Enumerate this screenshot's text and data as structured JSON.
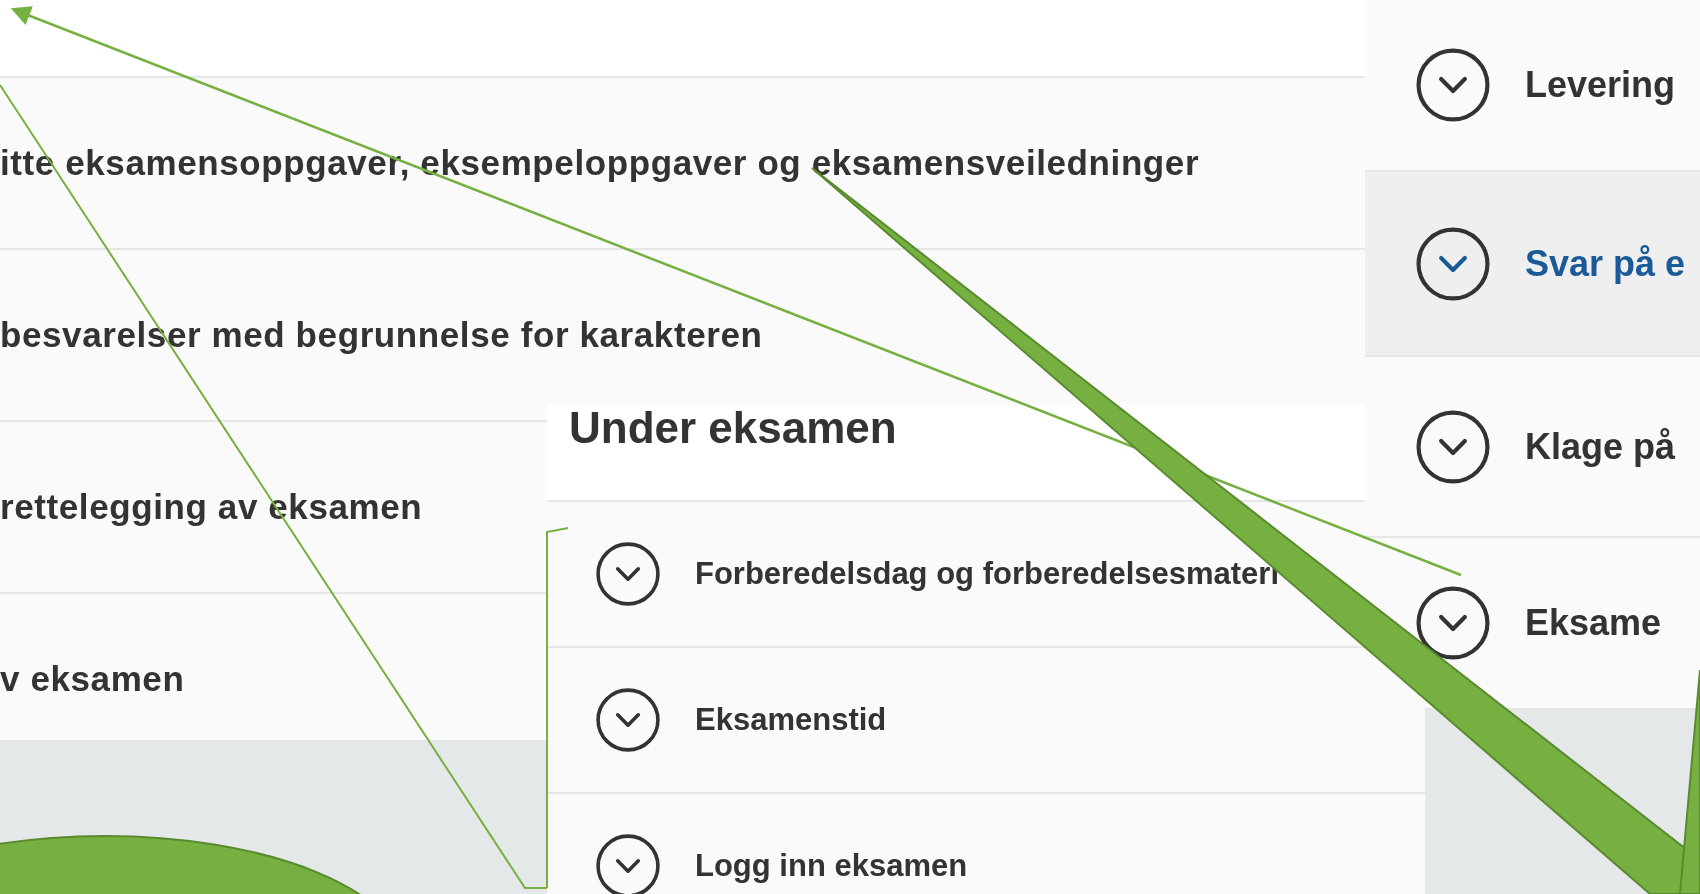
{
  "left_panel": {
    "items": [
      {
        "label": "itte eksamensoppgaver, eksempeloppgaver og eksamensveiledninger"
      },
      {
        "label": "besvarelser med begrunnelse for karakteren"
      },
      {
        "label": "rettelegging av eksamen"
      },
      {
        "label": "v eksamen"
      }
    ]
  },
  "middle_panel": {
    "heading": "Under eksamen",
    "items": [
      {
        "label": "Forberedelsdag og forberedelsesmateri"
      },
      {
        "label": "Eksamenstid"
      },
      {
        "label": "Logg inn eksamen"
      }
    ]
  },
  "right_panel": {
    "items": [
      {
        "label": "Levering",
        "selected": false
      },
      {
        "label": "Svar på e",
        "selected": true
      },
      {
        "label": "Klage på",
        "selected": false
      },
      {
        "label": "Eksame",
        "selected": false
      }
    ]
  }
}
